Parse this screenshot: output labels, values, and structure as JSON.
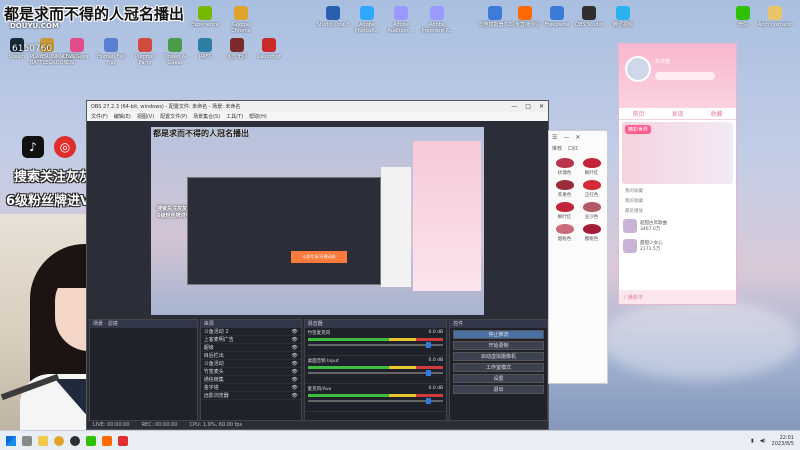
{
  "overlay": {
    "banner": "都是求而不得的人冠名播出",
    "watermark": "DOUYU.COM",
    "room_id": "6150760",
    "promo_line1": "搜索关注灰灰酱",
    "promo_line2": "6级粉丝牌进VX群"
  },
  "desktop_icons": [
    {
      "label": "Steam",
      "color": "#1b2838"
    },
    {
      "label": "PLAYERUNKNOWN'S BATTLEGROUNDS",
      "color": "#c99a3a"
    },
    {
      "label": "Fall Guys",
      "color": "#e04d8a"
    },
    {
      "label": "Human Fall Flat",
      "color": "#5a7fd1"
    },
    {
      "label": "Pummel Party",
      "color": "#d24a3d"
    },
    {
      "label": "Drawn & Guess",
      "color": "#4b9a4a"
    },
    {
      "label": "RAFT",
      "color": "#2f7ea3"
    },
    {
      "label": "永劫无间",
      "color": "#7a2a2a"
    },
    {
      "label": "Launcher",
      "color": "#c92b2b"
    },
    {
      "label": "Experience",
      "color": "#76b900"
    },
    {
      "label": "Google Chrome",
      "color": "#dfa32b"
    },
    {
      "label": "Studio One 3",
      "color": "#2a5fb0"
    },
    {
      "label": "Adobe Photosh...",
      "color": "#31a8ff"
    },
    {
      "label": "Adobe Audition ...",
      "color": "#9999ff"
    },
    {
      "label": "Adobe Premiere P...",
      "color": "#9999ff"
    },
    {
      "label": "雷电模拟器7.2",
      "color": "#3e7bd8"
    },
    {
      "label": "斗鱼直播伴侣",
      "color": "#ff6a00"
    },
    {
      "label": "Freeplane",
      "color": "#3b7bd8"
    },
    {
      "label": "OBS Studio",
      "color": "#302e31"
    },
    {
      "label": "腾讯视频",
      "color": "#2bb0f0"
    },
    {
      "label": "微信",
      "color": "#2dc100"
    },
    {
      "label": "Administrator",
      "color": "#e9c46a"
    }
  ],
  "obs": {
    "title": "OBS 27.2.3 (64-bit, windows) - 配置文件: 未命名 - 场景: 未命名",
    "menu": [
      "文件(F)",
      "编辑(E)",
      "视图(V)",
      "配置文件(P)",
      "场景集合(S)",
      "工具(T)",
      "帮助(H)"
    ],
    "scenes_header": "场景",
    "filters_header": "滤镜",
    "sources_header": "来源",
    "sources": [
      "斗鱼活动 2",
      "上客麦明广告",
      "超级",
      "目后栏出",
      "斗鱼活动",
      "竹签麦头",
      "通信链集",
      "金字塔",
      "远影浏览器"
    ],
    "mixer_header": "混音器",
    "mixer": [
      {
        "name": "竹签麦克风",
        "db": "0.0 dB"
      },
      {
        "name": "桌面音频 Input",
        "db": "0.0 dB"
      },
      {
        "name": "麦克风/Aux",
        "db": "0.0 dB"
      }
    ],
    "controls_header": "控件",
    "controls": [
      "停止推流",
      "开始录制",
      "启动虚拟摄像机",
      "工作室模式",
      "设置",
      "退出"
    ],
    "status": [
      "LIVE: 00:00:00",
      "REC: 00:00:00",
      "CPU: 1.9%, 60.00 fps"
    ],
    "orange_tag": "斗鱼专享/开播动态"
  },
  "lipstick_window": {
    "tabs": [
      "推荐",
      "口红"
    ],
    "items": [
      "玫瑰色",
      "枫叶红",
      "浆果色",
      "正红色",
      "枫叶红",
      "豆沙色",
      "烟粉色",
      "樱桃色"
    ]
  },
  "music_window": {
    "user_name": "灰灰酱",
    "nav": [
      "首页",
      "发现",
      "收藏"
    ],
    "banner_tag": "精彩世界",
    "menu": [
      "我的收藏",
      "我的收藏",
      "最近播放"
    ],
    "cards": [
      {
        "title": "超甜古风歌曲",
        "meta": "3467.0万"
      },
      {
        "title": "甜甜少女心",
        "meta": "2171.5万"
      }
    ],
    "footer": "♪ 播放中"
  },
  "taskbar": {
    "time": "22:01",
    "date": "2023/8/5"
  },
  "colors": {
    "accent_pink": "#ff5b8d",
    "obs_bg": "#2b2e38",
    "stop_stream_active": "#4a6fa5"
  }
}
